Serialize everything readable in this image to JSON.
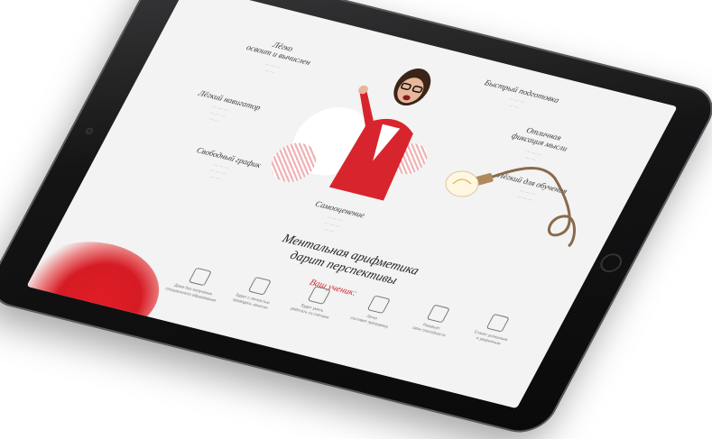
{
  "screen": {
    "labels": [
      {
        "id": "top-left-label",
        "text": "Лёгко\nосвоит и вычислен"
      },
      {
        "id": "top-right-label",
        "text": "Быстрый подготовка"
      },
      {
        "id": "mid-right-label",
        "text": "Отличная\nфиксация мысли"
      },
      {
        "id": "left-label-2",
        "text": "Лёгкий навигатор"
      },
      {
        "id": "right-label-3",
        "text": "Лёгкий для обучения"
      },
      {
        "id": "left-label-3",
        "text": "Свободный график"
      },
      {
        "id": "center-label",
        "text": "Самооценение"
      }
    ],
    "headline_line1": "Ментальная арифметика",
    "headline_line2": "дарит перспективы",
    "subheadline": "Ваш ученик:",
    "features": [
      {
        "icon": "clipboard-icon",
        "text": "Даже без получения\nспециального образования"
      },
      {
        "icon": "graduation-cap-icon",
        "text": "Будет с легкостью\nпроводить занятия"
      },
      {
        "icon": "chart-board-icon",
        "text": "Будет уметь\nработать со счётами"
      },
      {
        "icon": "group-icon",
        "text": "Легко\nсоставит программу"
      },
      {
        "icon": "brain-icon",
        "text": "Разовьёт\nсвои способности"
      },
      {
        "icon": "scales-icon",
        "text": "Станет успешным\nи уверенным"
      }
    ]
  },
  "colors": {
    "accent": "#d3262e",
    "frame": "#151516"
  }
}
